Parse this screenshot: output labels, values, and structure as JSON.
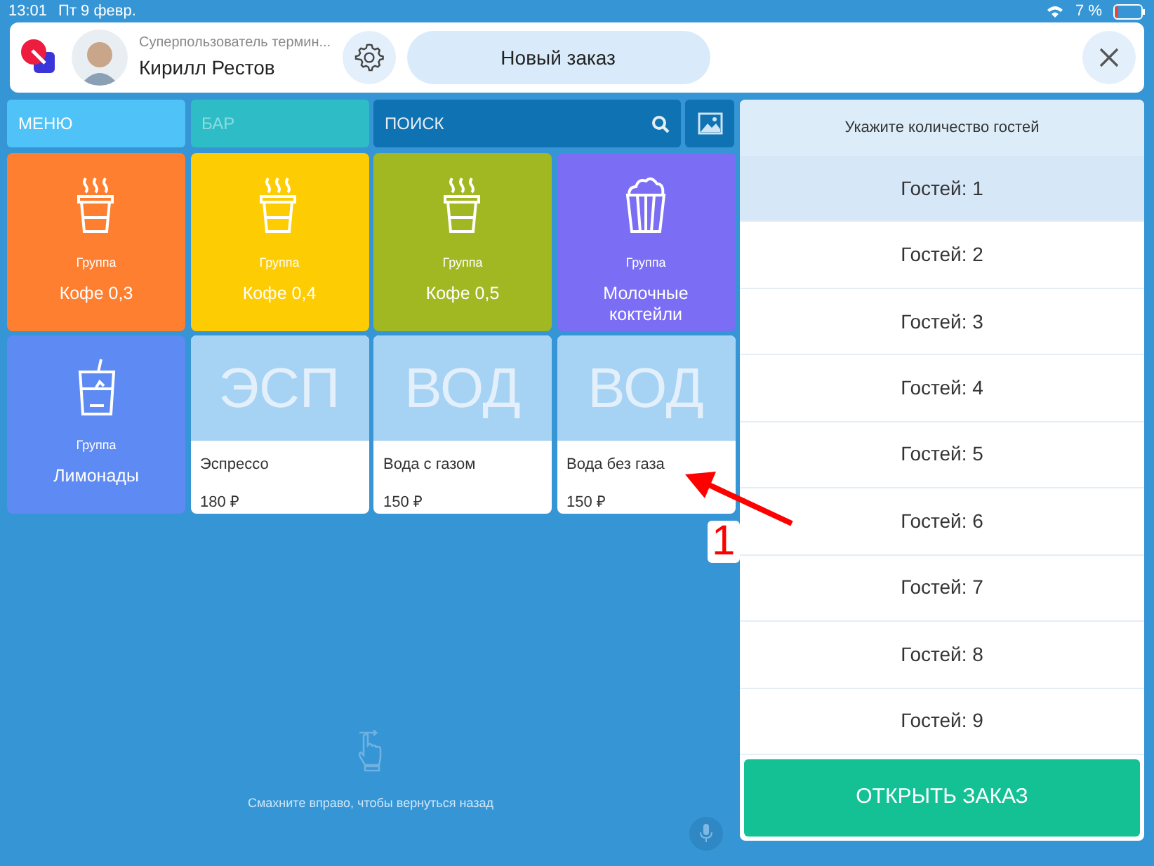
{
  "status_bar": {
    "time": "13:01",
    "date": "Пт 9 февр.",
    "battery": "7 %"
  },
  "header": {
    "user_role": "Суперпользователь термин...",
    "user_name": "Кирилл Рестов",
    "new_order": "Новый заказ"
  },
  "tabs": [
    {
      "label": "МЕНЮ",
      "selected": true,
      "color": "#4fc3f7"
    },
    {
      "label": "БАР",
      "selected": false,
      "color": "#2ebdc6"
    }
  ],
  "search": {
    "placeholder": "ПОИСК"
  },
  "tiles": [
    {
      "kind": "group",
      "caption": "Группа",
      "name": "Кофе 0,3",
      "color": "#fe7f30"
    },
    {
      "kind": "group",
      "caption": "Группа",
      "name": "Кофе 0,4",
      "color": "#fecc02"
    },
    {
      "kind": "group",
      "caption": "Группа",
      "name": "Кофе 0,5",
      "color": "#a2b822"
    },
    {
      "kind": "group",
      "caption": "Группа",
      "name": "Молочные коктейли",
      "color": "#7b6ef4"
    },
    {
      "kind": "group",
      "caption": "Группа",
      "name": "Лимонады",
      "color": "#5e8af3"
    },
    {
      "kind": "product",
      "abbrev": "ЭСП",
      "name": "Эспрессо",
      "price": "180 ₽"
    },
    {
      "kind": "product",
      "abbrev": "ВОД",
      "name": "Вода с газом",
      "price": "150 ₽"
    },
    {
      "kind": "product",
      "abbrev": "ВОД",
      "name": "Вода без газа",
      "price": "150 ₽"
    }
  ],
  "swipe_hint": "Смахните вправо, чтобы вернуться назад",
  "guests": {
    "title": "Укажите количество гостей",
    "options": [
      {
        "label": "Гостей: 1",
        "selected": true
      },
      {
        "label": "Гостей: 2",
        "selected": false
      },
      {
        "label": "Гостей: 3",
        "selected": false
      },
      {
        "label": "Гостей: 4",
        "selected": false
      },
      {
        "label": "Гостей: 5",
        "selected": false
      },
      {
        "label": "Гостей: 6",
        "selected": false
      },
      {
        "label": "Гостей: 7",
        "selected": false
      },
      {
        "label": "Гостей: 8",
        "selected": false
      },
      {
        "label": "Гостей: 9",
        "selected": false
      }
    ],
    "open_button": "ОТКРЫТЬ ЗАКАЗ"
  },
  "annotation": {
    "label": "1"
  }
}
